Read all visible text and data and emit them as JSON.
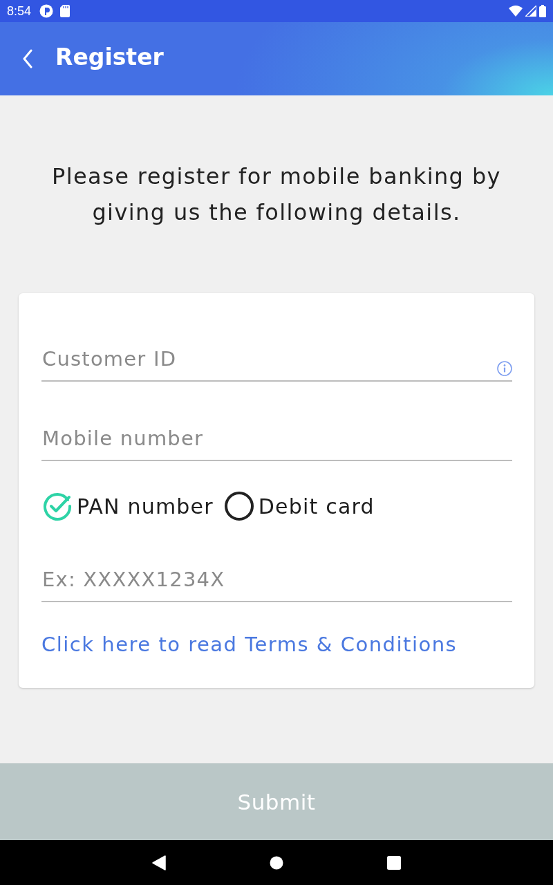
{
  "status_bar": {
    "time": "8:54"
  },
  "app_bar": {
    "title": "Register"
  },
  "intro": "Please register for mobile banking by giving us the following details.",
  "form": {
    "fields": [
      {
        "placeholder": "Customer ID",
        "info": true
      },
      {
        "placeholder": "Mobile number",
        "info": false
      }
    ],
    "id_types": [
      {
        "label": "PAN number",
        "selected": true
      },
      {
        "label": "Debit card",
        "selected": false
      }
    ],
    "id_field": {
      "placeholder": "Ex: XXXXX1234X"
    },
    "terms_link": "Click here to read Terms & Conditions"
  },
  "submit": {
    "label": "Submit",
    "disabled": true
  }
}
